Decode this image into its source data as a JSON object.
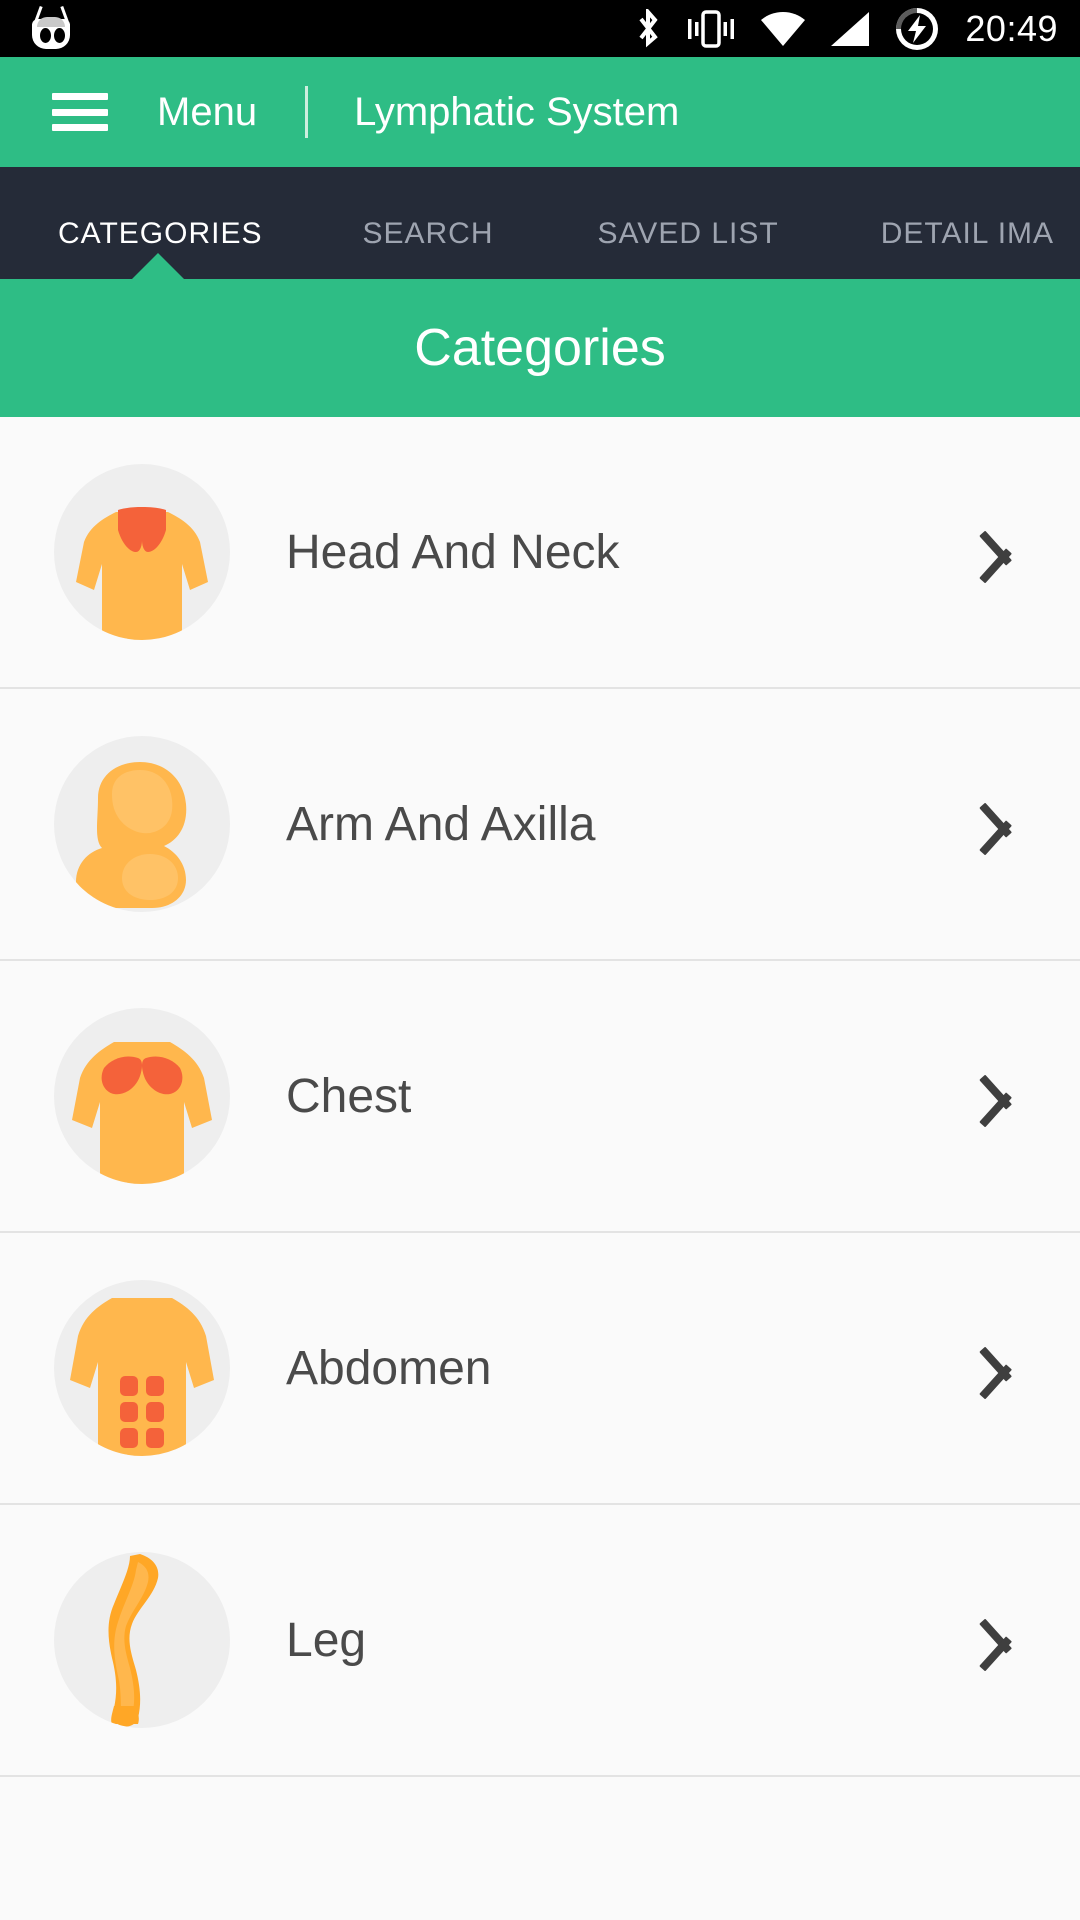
{
  "status_bar": {
    "logo_icon": "cyanogenmod-logo-icon",
    "icons": [
      "bluetooth-icon",
      "vibrate-icon",
      "wifi-icon",
      "cellular-signal-icon",
      "battery-charging-icon"
    ],
    "time": "20:49"
  },
  "app_bar": {
    "menu_icon": "hamburger-menu-icon",
    "menu_label": "Menu",
    "title": "Lymphatic System",
    "background_color": "#2ebd85"
  },
  "tabs": {
    "active_index": 0,
    "items": [
      {
        "label": "CATEGORIES"
      },
      {
        "label": "SEARCH"
      },
      {
        "label": "SAVED LIST"
      },
      {
        "label": "DETAIL IMA"
      }
    ],
    "background_color": "#252b38",
    "active_color": "#ffffff",
    "inactive_color": "#9ea4b0"
  },
  "section_header": {
    "title": "Categories"
  },
  "categories": [
    {
      "label": "Head And Neck",
      "icon": "torso-neck-icon",
      "chevron": "chevron-right-icon"
    },
    {
      "label": "Arm And Axilla",
      "icon": "flexed-arm-icon",
      "chevron": "chevron-right-icon"
    },
    {
      "label": "Chest",
      "icon": "torso-chest-icon",
      "chevron": "chevron-right-icon"
    },
    {
      "label": "Abdomen",
      "icon": "torso-abs-icon",
      "chevron": "chevron-right-icon"
    },
    {
      "label": "Leg",
      "icon": "leg-icon",
      "chevron": "chevron-right-icon"
    }
  ],
  "palette": {
    "green": "#2ebd85",
    "dark": "#252b38",
    "body_fill": "#ffb74d",
    "highlight_fill": "#f4623a",
    "list_bg": "#fafafa",
    "divider": "#e3e3e3",
    "label_text": "#4a4a4a"
  }
}
